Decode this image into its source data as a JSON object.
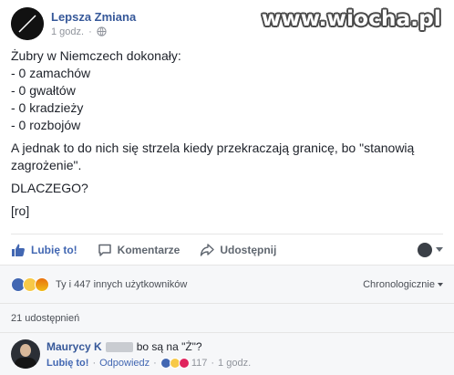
{
  "header": {
    "page_name": "Lepsza Zmiana",
    "time": "1 godz.",
    "separator": "·",
    "watermark": "www.wiocha.pl"
  },
  "post": {
    "lines": [
      "Żubry w Niemczech dokonały:",
      "- 0 zamachów",
      "- 0 gwałtów",
      "- 0 kradzieży",
      "- 0 rozbojów",
      "A jednak to do nich się strzela kiedy przekraczają granicę, bo \"stanowią zagrożenie\".",
      "DLACZEGO?",
      "[ro]"
    ]
  },
  "actions": {
    "like": "Lubię to!",
    "comment": "Komentarze",
    "share": "Udostępnij"
  },
  "reactions": {
    "text": "Ty i 447 innych użytkowników",
    "sort": "Chronologicznie",
    "icons": [
      "like-icon",
      "sad-icon",
      "angry-icon"
    ]
  },
  "shares": {
    "text": "21 udostępnień"
  },
  "comment": {
    "author": "Maurycy K",
    "text": "bo są na \"Ż\"?",
    "like": "Lubię to!",
    "reply": "Odpowiedz",
    "reaction_count": "117",
    "time": "1 godz.",
    "sep": "·"
  },
  "colors": {
    "link": "#365899",
    "accent": "#4267b2",
    "muted": "#90949c"
  }
}
